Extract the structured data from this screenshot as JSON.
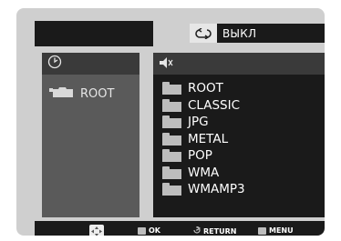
{
  "repeat": {
    "icon": "repeat-icon",
    "label": "ВЫКЛ"
  },
  "left_panel": {
    "header_icon": "clock-icon",
    "tree": [
      {
        "label": "ROOT",
        "icon": "folder-open-icon"
      }
    ]
  },
  "right_panel": {
    "header_icon": "speaker-icon",
    "files": [
      {
        "label": "ROOT"
      },
      {
        "label": "CLASSIC"
      },
      {
        "label": "JPG"
      },
      {
        "label": "METAL"
      },
      {
        "label": "POP"
      },
      {
        "label": "WMA"
      },
      {
        "label": "WMAMP3"
      }
    ]
  },
  "bottom_bar": {
    "nav_icon": "dpad-icon",
    "ok_label": "OK",
    "return_label": "RETURN",
    "menu_label": "MENU"
  },
  "colors": {
    "panel_dark": "#1a1a1a",
    "panel_mid": "#5a5a5a",
    "background": "#cfcfcf"
  }
}
